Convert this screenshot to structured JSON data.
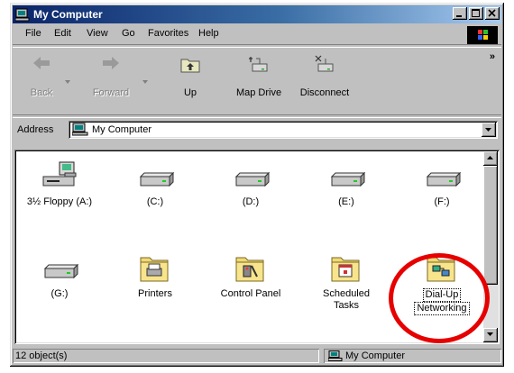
{
  "window": {
    "title": "My Computer"
  },
  "menu": {
    "file": "File",
    "edit": "Edit",
    "view": "View",
    "go": "Go",
    "favorites": "Favorites",
    "help": "Help"
  },
  "toolbar": {
    "back": "Back",
    "forward": "Forward",
    "up": "Up",
    "map_drive": "Map Drive",
    "disconnect": "Disconnect",
    "more": "»"
  },
  "address": {
    "label": "Address",
    "value": "My Computer"
  },
  "files": [
    {
      "label": "3½ Floppy (A:)",
      "icon": "floppy-drive-icon"
    },
    {
      "label": "(C:)",
      "icon": "hard-drive-icon"
    },
    {
      "label": "(D:)",
      "icon": "hard-drive-icon"
    },
    {
      "label": "(E:)",
      "icon": "hard-drive-icon"
    },
    {
      "label": "(F:)",
      "icon": "hard-drive-icon"
    },
    {
      "label": "(G:)",
      "icon": "hard-drive-icon"
    },
    {
      "label": "Printers",
      "icon": "printers-folder-icon"
    },
    {
      "label": "Control Panel",
      "icon": "control-panel-folder-icon"
    },
    {
      "label": "Scheduled Tasks",
      "label_line1": "Scheduled",
      "label_line2": "Tasks",
      "icon": "scheduled-tasks-folder-icon"
    },
    {
      "label": "Dial-Up Networking",
      "label_line1": "Dial-Up",
      "label_line2": "Networking",
      "icon": "dialup-networking-folder-icon",
      "selected": true
    }
  ],
  "status": {
    "count": "12 object(s)",
    "location": "My Computer"
  },
  "colors": {
    "title_start": "#0a246a",
    "title_end": "#a6caf0",
    "highlight_circle": "#e60000",
    "face": "#c0c0c0"
  }
}
